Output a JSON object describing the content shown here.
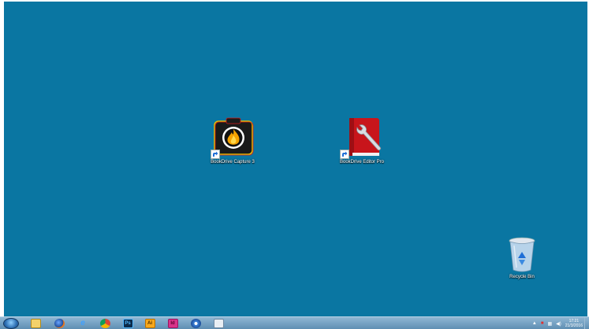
{
  "desktop": {
    "background": "#0a76a2",
    "icons": [
      {
        "label": "BookDrive Capture 3",
        "icon": "camera-flame-icon"
      },
      {
        "label": "BookDrive Editor Pro",
        "icon": "book-wrench-icon"
      },
      {
        "label": "Recycle Bin",
        "icon": "recycle-bin-icon"
      }
    ]
  },
  "taskbar": {
    "start": {
      "icon": "windows-start-orb-icon"
    },
    "pinned": [
      {
        "name": "windows-explorer",
        "icon": "folder-icon"
      },
      {
        "name": "firefox",
        "icon": "firefox-icon"
      },
      {
        "name": "internet-explorer",
        "icon": "internet-explorer-icon"
      },
      {
        "name": "chrome",
        "icon": "chrome-icon"
      },
      {
        "name": "photoshop",
        "icon": "photoshop-icon",
        "text": "Ps"
      },
      {
        "name": "illustrator",
        "icon": "illustrator-icon",
        "text": "Ai"
      },
      {
        "name": "indesign",
        "icon": "indesign-icon",
        "text": "Id"
      },
      {
        "name": "itunes",
        "icon": "itunes-icon"
      },
      {
        "name": "network",
        "icon": "network-icon"
      }
    ],
    "tray": {
      "icons": [
        "show-hidden-icons-icon",
        "security-icon",
        "network-status-icon",
        "volume-icon"
      ],
      "time": "17:21",
      "date": "21/3/2016"
    }
  }
}
